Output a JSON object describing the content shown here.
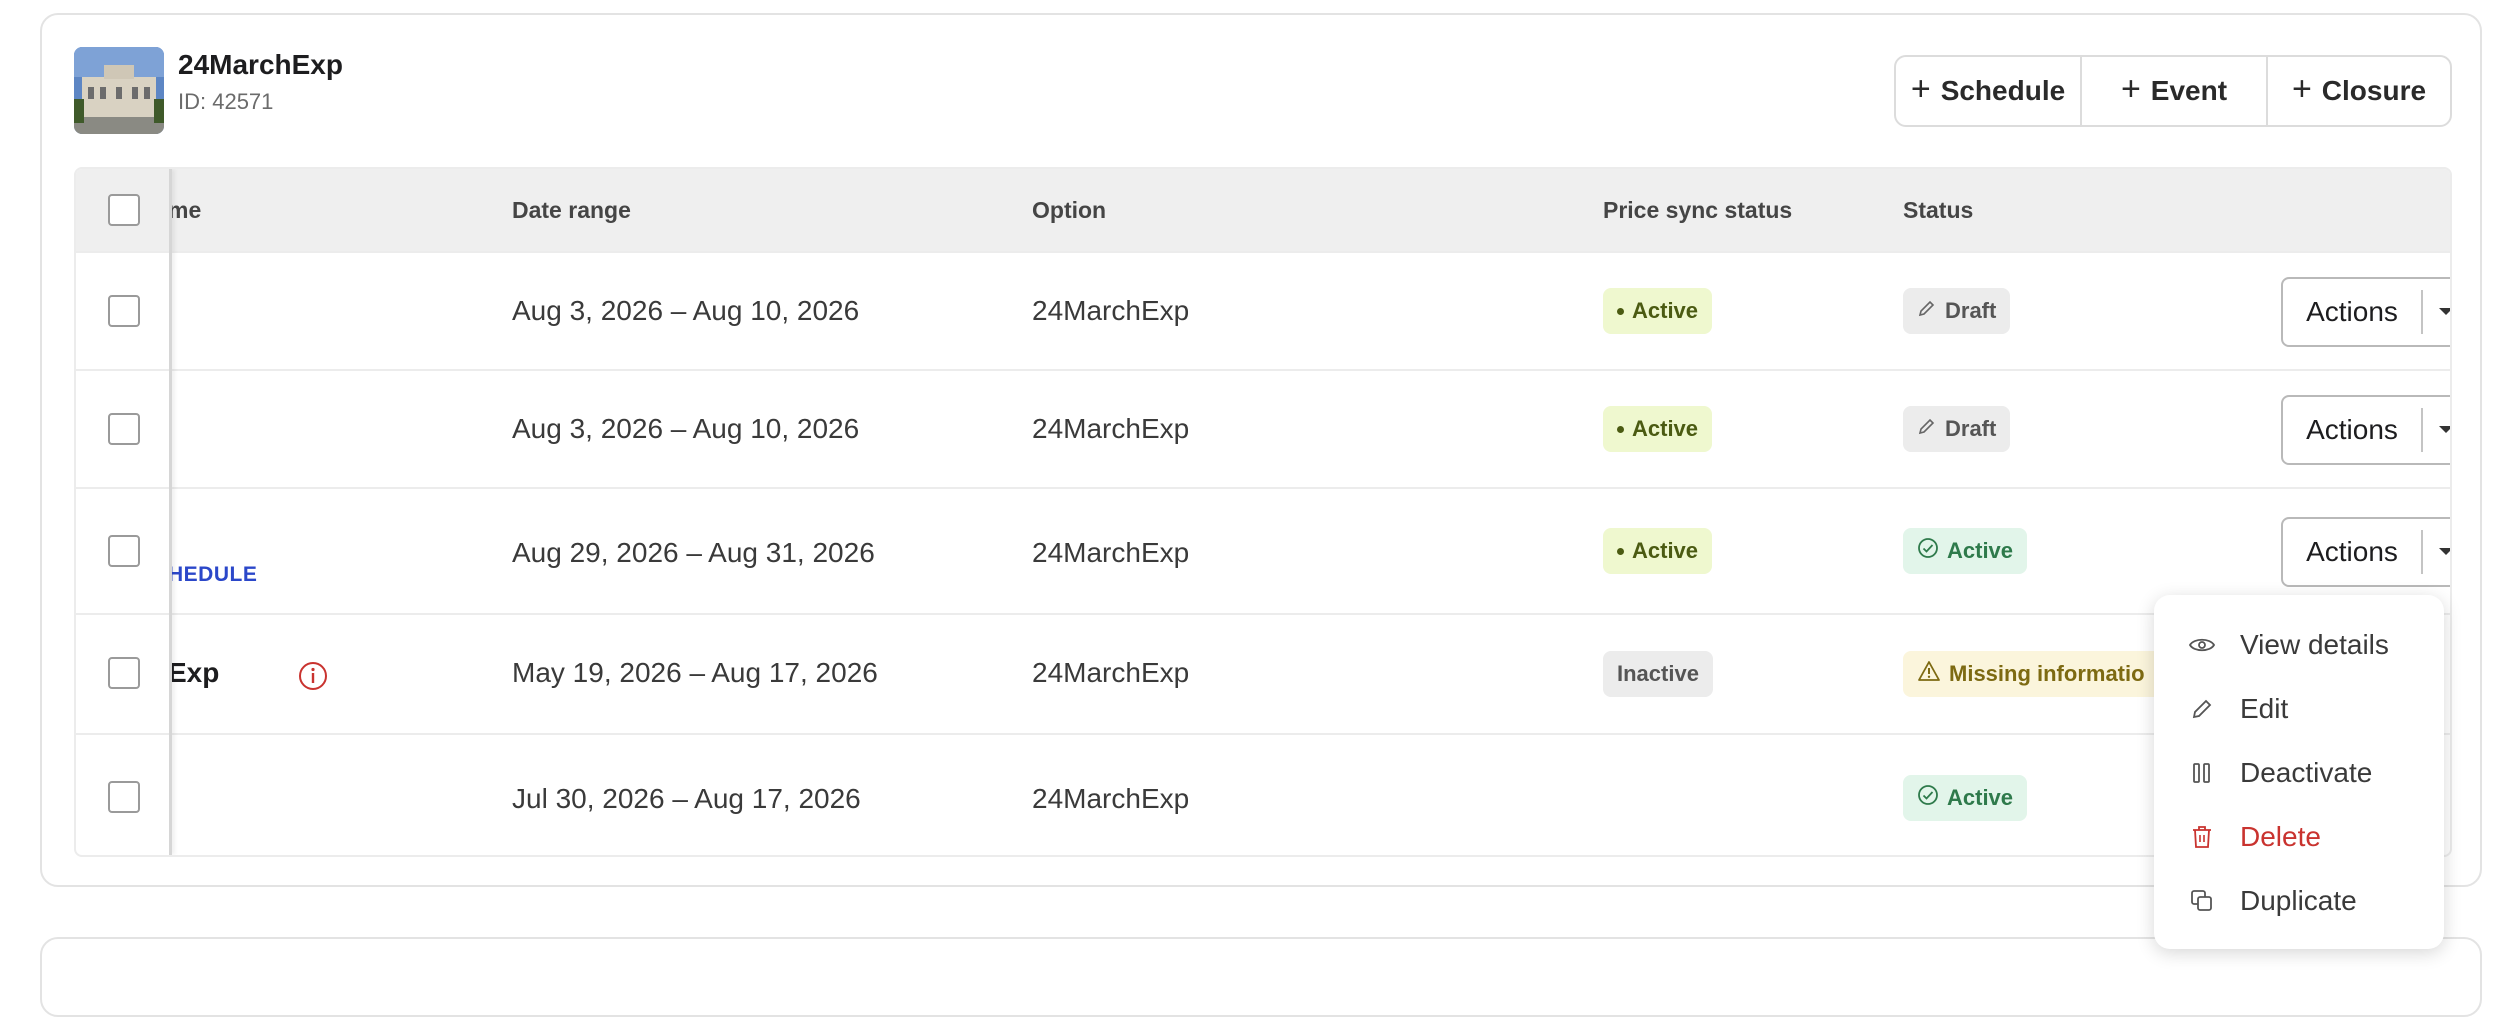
{
  "experience": {
    "title": "24MarchExp",
    "id_text": "ID: 42571"
  },
  "header_buttons": {
    "schedule": "Schedule",
    "event": "Event",
    "closure": "Closure"
  },
  "table": {
    "columns": {
      "name": "me",
      "date_range": "Date range",
      "option": "Option",
      "price_sync": "Price sync status",
      "status": "Status"
    },
    "rows": [
      {
        "name": "",
        "date_range": "Aug 3, 2026 – Aug 10, 2026",
        "option": "24MarchExp",
        "price_sync": "Active",
        "status": "Draft",
        "actions": "Actions"
      },
      {
        "name": "",
        "date_range": "Aug 3, 2026 – Aug 10, 2026",
        "option": "24MarchExp",
        "price_sync": "Active",
        "status": "Draft",
        "actions": "Actions"
      },
      {
        "name": "HEDULE",
        "date_range": "Aug 29, 2026 – Aug 31, 2026",
        "option": "24MarchExp",
        "price_sync": "Active",
        "status": "Active",
        "actions": "Actions"
      },
      {
        "name": "Exp",
        "date_range": "May 19, 2026 – Aug 17, 2026",
        "option": "24MarchExp",
        "price_sync": "Inactive",
        "status": "Missing informatio"
      },
      {
        "name": "",
        "date_range": "Jul 30, 2026 – Aug 17, 2026",
        "option": "24MarchExp",
        "price_sync": "",
        "status": "Active"
      }
    ]
  },
  "actions_menu": {
    "view_details": "View details",
    "edit": "Edit",
    "deactivate": "Deactivate",
    "delete": "Delete",
    "duplicate": "Duplicate"
  },
  "colors": {
    "link_blue": "#2b47c9",
    "danger_red": "#c9332f",
    "sync_active_bg": "#eff8cf",
    "status_active_bg": "#e2f5ea",
    "status_missing_bg": "#fbf5dc"
  }
}
